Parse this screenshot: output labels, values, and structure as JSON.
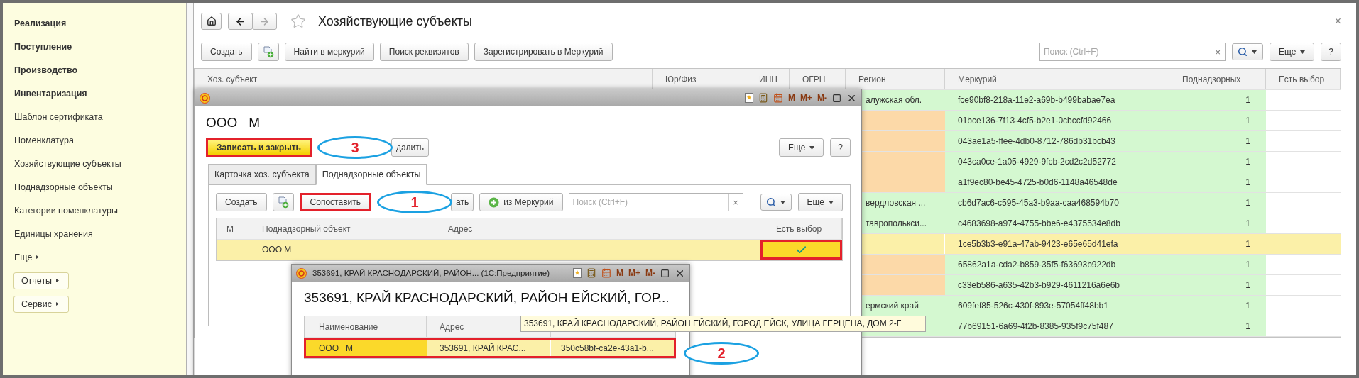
{
  "sidebar": {
    "items": [
      {
        "kind": "section",
        "label": "Реализация"
      },
      {
        "kind": "section",
        "label": "Поступление"
      },
      {
        "kind": "section",
        "label": "Производство"
      },
      {
        "kind": "section",
        "label": "Инвентаризация"
      },
      {
        "kind": "link",
        "label": "Шаблон сертификата"
      },
      {
        "kind": "link",
        "label": "Номенклатура"
      },
      {
        "kind": "link",
        "label": "Хозяйствующие субъекты"
      },
      {
        "kind": "link",
        "label": "Поднадзорные объекты"
      },
      {
        "kind": "link",
        "label": "Категории номенклатуры"
      },
      {
        "kind": "link",
        "label": "Единицы хранения"
      },
      {
        "kind": "more",
        "label": "Еще"
      },
      {
        "kind": "button",
        "label": "Отчеты"
      },
      {
        "kind": "button",
        "label": "Сервис"
      }
    ]
  },
  "page": {
    "title": "Хозяйствующие субъекты",
    "close": "×",
    "toolbar": {
      "buttons": [
        {
          "kind": "text",
          "label": "Создать"
        },
        {
          "kind": "icon"
        },
        {
          "kind": "text",
          "label": "Найти в меркурий"
        },
        {
          "kind": "text",
          "label": "Поиск реквизитов"
        },
        {
          "kind": "text",
          "label": "Зарегистрировать в Меркурий"
        }
      ],
      "search": {
        "placeholder": "Поиск (Ctrl+F)",
        "clear": "×"
      },
      "more": "Еще",
      "help": "?"
    }
  },
  "table": {
    "columns": [
      "Хоз. субъект",
      "Юр/Физ",
      "ИНН",
      "ОГРН",
      "Регион",
      "Меркурий",
      "Поднадзорных",
      "Есть выбор"
    ],
    "rows": [
      {
        "region": "алужская обл.",
        "color": "#d4f8d0",
        "mercury": "fce90bf8-218a-11e2-a69b-b499babae7ea",
        "count": "1",
        "selected": false
      },
      {
        "color": "#fcd9a8",
        "mercury": "01bce136-7f13-4cf5-b2e1-0cbccfd92466",
        "count": "1",
        "selected": false
      },
      {
        "color": "#fcd9a8",
        "mercury": "043ae1a5-ffee-4db0-8712-786db31bcb43",
        "count": "1",
        "selected": false
      },
      {
        "color": "#fcd9a8",
        "mercury": "043ca0ce-1a05-4929-9fcb-2cd2c2d52772",
        "count": "1",
        "selected": false
      },
      {
        "color": "#fcd9a8",
        "mercury": "a1f9ec80-be45-4725-b0d6-1148a46548de",
        "count": "1",
        "selected": false
      },
      {
        "region": "вердловская ...",
        "color": "#d4f8d0",
        "mercury": "cb6d7ac6-c595-45a3-b9aa-caa468594b70",
        "count": "1",
        "selected": false
      },
      {
        "region": "таврополькси...",
        "color": "#d4f8d0",
        "mercury": "c4683698-a974-4755-bbe6-e4375534e8db",
        "count": "1",
        "selected": false
      },
      {
        "mercury": "1ce5b3b3-e91a-47ab-9423-e65e65d41efa",
        "count": "1",
        "selected": true
      },
      {
        "color": "#fcd9a8",
        "mercury": "65862a1a-cda2-b859-35f5-f63693b922db",
        "count": "1",
        "selected": false
      },
      {
        "color": "#fcd9a8",
        "mercury": "c33eb586-a635-42b3-b929-4611216a6e6b",
        "count": "1",
        "selected": false
      },
      {
        "region": "ермский край",
        "color": "#d4f8d0",
        "mercury": "609fef85-526c-430f-893e-57054ff48bb1",
        "count": "1",
        "selected": false
      },
      {
        "color": "#d4f8d0",
        "mercury": "77b69151-6a69-4f2b-8385-935f9c75f487",
        "count": "1",
        "selected": false
      }
    ]
  },
  "subject_dialog": {
    "title_tools": [
      "M",
      "M+",
      "M-"
    ],
    "heading": "ООО   М",
    "commands": [
      {
        "kind": "primary",
        "label": "Записать и закрыть",
        "highlighted": true
      },
      {
        "kind": "plain",
        "label": "далить",
        "highlighted": false,
        "callout": "3"
      }
    ],
    "more": "Еще",
    "help": "?",
    "tabs": [
      {
        "label": "Карточка хоз. субъекта",
        "selected": false
      },
      {
        "label": "Поднадзорные объекты",
        "selected": true
      }
    ],
    "toolbar": {
      "buttons": [
        {
          "kind": "text",
          "label": "Создать",
          "highlighted": false
        },
        {
          "kind": "icon",
          "highlighted": false
        },
        {
          "kind": "text",
          "label": "Сопоставить",
          "highlighted": true
        },
        {
          "kind": "text",
          "label": "ать",
          "highlighted": false,
          "callout": "1"
        },
        {
          "kind": "plus",
          "label": "из Меркурий",
          "highlighted": false
        }
      ],
      "search": {
        "placeholder": "Поиск (Ctrl+F)",
        "clear": "×"
      },
      "more": "Еще"
    },
    "grid": {
      "columns": [
        "М",
        "Поднадзорный объект",
        "Адрес",
        "Есть выбор"
      ],
      "rows": [
        {
          "object": "ООО М",
          "chosen": true,
          "highlighted": true,
          "selected": true
        }
      ]
    }
  },
  "address_dialog": {
    "title": "353691, КРАЙ КРАСНОДАРСКИЙ, РАЙОН... (1С:Предприятие)",
    "title_tools": [
      "M",
      "M+",
      "M-"
    ],
    "heading": "353691, КРАЙ КРАСНОДАРСКИЙ, РАЙОН ЕЙСКИЙ, ГОР...",
    "grid": {
      "columns": [
        "Наименование",
        "Адрес"
      ],
      "rows": [
        {
          "name": "ООО   М",
          "address": "353691, КРАЙ КРАС...",
          "mercury": "350c58bf-ca2e-43a1-b...",
          "selected": true,
          "highlighted": true,
          "callout": "2"
        }
      ]
    },
    "tooltip": "353691, КРАЙ КРАСНОДАРСКИЙ, РАЙОН ЕЙСКИЙ, ГОРОД ЕЙСК, УЛИЦА ГЕРЦЕНА, ДОМ 2-Г"
  }
}
